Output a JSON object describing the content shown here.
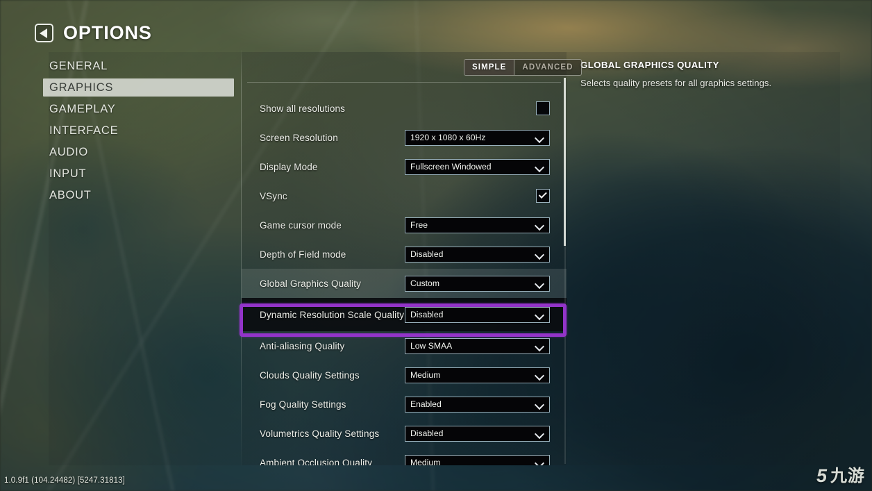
{
  "header": {
    "title": "OPTIONS",
    "back_icon": "back-arrow-icon"
  },
  "sidebar": {
    "items": [
      {
        "label": "GENERAL",
        "active": false
      },
      {
        "label": "GRAPHICS",
        "active": true
      },
      {
        "label": "GAMEPLAY",
        "active": false
      },
      {
        "label": "INTERFACE",
        "active": false
      },
      {
        "label": "AUDIO",
        "active": false
      },
      {
        "label": "INPUT",
        "active": false
      },
      {
        "label": "ABOUT",
        "active": false
      }
    ]
  },
  "mode_toggle": {
    "simple_label": "SIMPLE",
    "advanced_label": "ADVANCED",
    "selected": "SIMPLE"
  },
  "settings": {
    "rows": [
      {
        "label": "Show all resolutions",
        "control": "checkbox",
        "checked": false
      },
      {
        "label": "Screen Resolution",
        "control": "dropdown",
        "value": "1920 x 1080 x 60Hz"
      },
      {
        "label": "Display Mode",
        "control": "dropdown",
        "value": "Fullscreen Windowed"
      },
      {
        "label": "VSync",
        "control": "checkbox",
        "checked": true
      },
      {
        "label": "Game cursor mode",
        "control": "dropdown",
        "value": "Free"
      },
      {
        "label": "Depth of Field mode",
        "control": "dropdown",
        "value": "Disabled"
      },
      {
        "label": "Global Graphics Quality",
        "control": "dropdown",
        "value": "Custom"
      },
      {
        "label": "Dynamic Resolution Scale Quality",
        "control": "dropdown",
        "value": "Disabled"
      },
      {
        "label": "Anti-aliasing Quality",
        "control": "dropdown",
        "value": "Low SMAA"
      },
      {
        "label": "Clouds Quality Settings",
        "control": "dropdown",
        "value": "Medium"
      },
      {
        "label": "Fog Quality Settings",
        "control": "dropdown",
        "value": "Enabled"
      },
      {
        "label": "Volumetrics Quality Settings",
        "control": "dropdown",
        "value": "Disabled"
      },
      {
        "label": "Ambient Occlusion Quality",
        "control": "dropdown",
        "value": "Medium"
      }
    ]
  },
  "info_panel": {
    "title": "GLOBAL GRAPHICS QUALITY",
    "description": "Selects quality presets for all graphics settings."
  },
  "footer": {
    "version": "1.0.9f1 (104.24482) [5247.31813]"
  },
  "watermark": {
    "logo_text": "5",
    "brand_text": "九游"
  },
  "colors": {
    "focus_outline": "#9334c9",
    "control_border": "#9ab2bd",
    "control_bg": "#050507",
    "active_nav_bg": "#e4e7e0"
  }
}
